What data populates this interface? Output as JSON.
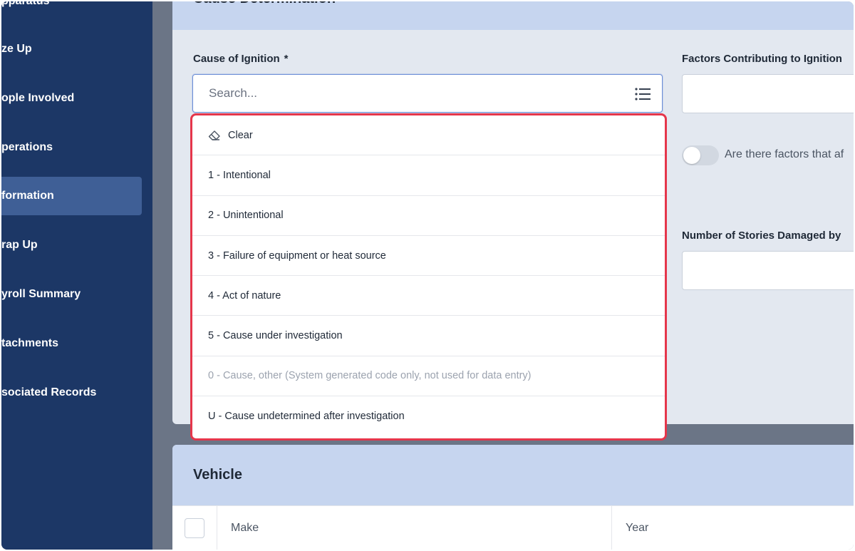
{
  "sidebar": {
    "items": [
      {
        "label": "pparatus",
        "active": false
      },
      {
        "label": "ze Up",
        "active": false
      },
      {
        "label": "ople Involved",
        "active": false
      },
      {
        "label": "perations",
        "active": false
      },
      {
        "label": "formation",
        "active": true
      },
      {
        "label": "rap Up",
        "active": false
      },
      {
        "label": "yroll Summary",
        "active": false
      },
      {
        "label": "tachments",
        "active": false
      },
      {
        "label": "sociated Records",
        "active": false
      }
    ]
  },
  "cause_section": {
    "title": "Cause Determination",
    "cause_label": "Cause of Ignition",
    "required_mark": "*",
    "search_placeholder": "Search...",
    "factors_label": "Factors Contributing to Ignition",
    "toggle_label": "Are there factors that af",
    "stories_label": "Number of Stories Damaged by"
  },
  "dropdown": {
    "clear_label": "Clear",
    "options": [
      {
        "label": "1 - Intentional",
        "disabled": false
      },
      {
        "label": "2 - Unintentional",
        "disabled": false
      },
      {
        "label": "3 - Failure of equipment or heat source",
        "disabled": false
      },
      {
        "label": "4 - Act of nature",
        "disabled": false
      },
      {
        "label": "5 - Cause under investigation",
        "disabled": false
      },
      {
        "label": "0 - Cause, other (System generated code only, not used for data entry)",
        "disabled": true
      },
      {
        "label": "U - Cause undetermined after investigation",
        "disabled": false
      }
    ]
  },
  "vehicle_section": {
    "title": "Vehicle",
    "columns": [
      "Make",
      "Year"
    ]
  },
  "colors": {
    "sidebar_bg": "#1c3766",
    "sidebar_active": "#3f5f96",
    "card_header": "#c6d5ef",
    "highlight_border": "#e5364b"
  }
}
